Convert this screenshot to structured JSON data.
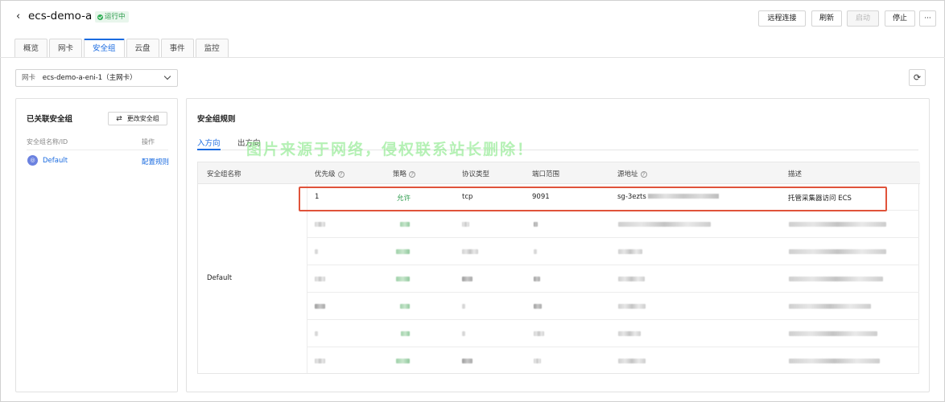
{
  "header": {
    "back_glyph": "‹",
    "title": "ecs-demo-a",
    "status": "运行中",
    "buttons": {
      "remote": "远程连接",
      "refresh": "刷新",
      "start": "启动",
      "stop": "停止",
      "more": "···"
    }
  },
  "tabs": [
    "概览",
    "网卡",
    "安全组",
    "云盘",
    "事件",
    "监控"
  ],
  "nic_select": {
    "label": "网卡",
    "value": "ecs-demo-a-eni-1（主网卡）"
  },
  "left_panel": {
    "title": "已关联安全组",
    "change_button": "更改安全组",
    "col_name": "安全组名称/ID",
    "col_action": "操作",
    "group_name": "Default",
    "group_action": "配置规则"
  },
  "right_panel": {
    "title": "安全组规则",
    "dir_in": "入方向",
    "dir_out": "出方向",
    "watermark": "图片来源于网络，侵权联系站长删除！",
    "columns": {
      "group": "安全组名称",
      "priority": "优先级",
      "policy": "策略",
      "protocol": "协议类型",
      "port": "端口范围",
      "source": "源地址",
      "desc": "描述"
    },
    "group_cell": "Default",
    "first_rule": {
      "priority": "1",
      "policy": "允许",
      "protocol": "tcp",
      "port": "9091",
      "source": "sg-3ezts",
      "desc": "托管采集器访问 ECS"
    }
  },
  "colors": {
    "accent": "#1a6be0",
    "running": "#2a9a4a",
    "highlight": "#e0533a",
    "watermark": "#78e678"
  }
}
